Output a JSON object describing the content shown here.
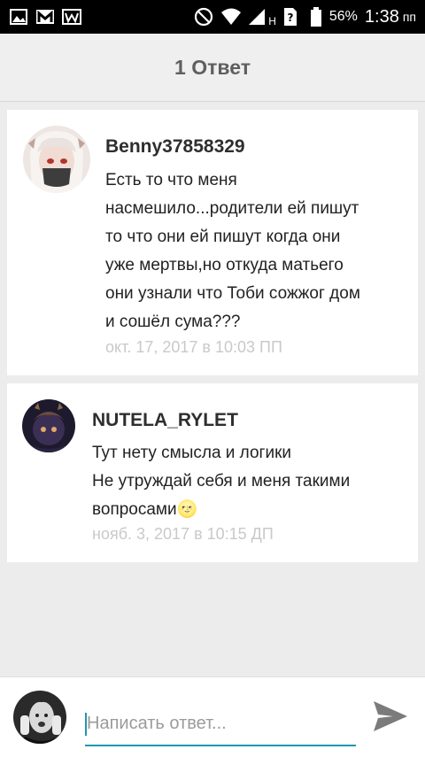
{
  "status_bar": {
    "network": "H",
    "battery_percent": "56%",
    "time": "1:38",
    "ampm": "пп"
  },
  "header": {
    "title": "1 Ответ"
  },
  "comments": [
    {
      "username": "Benny37858329",
      "lines": [
        "Есть то что меня",
        "насмешило...родители ей пишут",
        "то что они ей пишут когда они",
        "уже мертвы,но откуда матьего",
        "они узнали что Тоби сожжог дом",
        "и сошёл сума???"
      ],
      "date": "окт. 17, 2017 в 10:03 ПП"
    },
    {
      "username": "NUTELA_RYLET",
      "lines": [
        "Тут нету смысла и логики",
        "Не утруждай себя и меня такими",
        "вопросами"
      ],
      "emoji": "🌝",
      "date": "нояб. 3, 2017 в 10:15 ДП"
    }
  ],
  "reply": {
    "placeholder": "Написать ответ...",
    "value": ""
  },
  "colors": {
    "accent": "#1f98ad",
    "background": "#ececec",
    "date_text": "#c9c9c9"
  },
  "icons": [
    "gallery-icon",
    "mail-icon",
    "wordpress-icon",
    "do-not-disturb-icon",
    "wifi-icon",
    "signal-icon",
    "sim-unknown-icon",
    "battery-icon",
    "send-icon"
  ]
}
